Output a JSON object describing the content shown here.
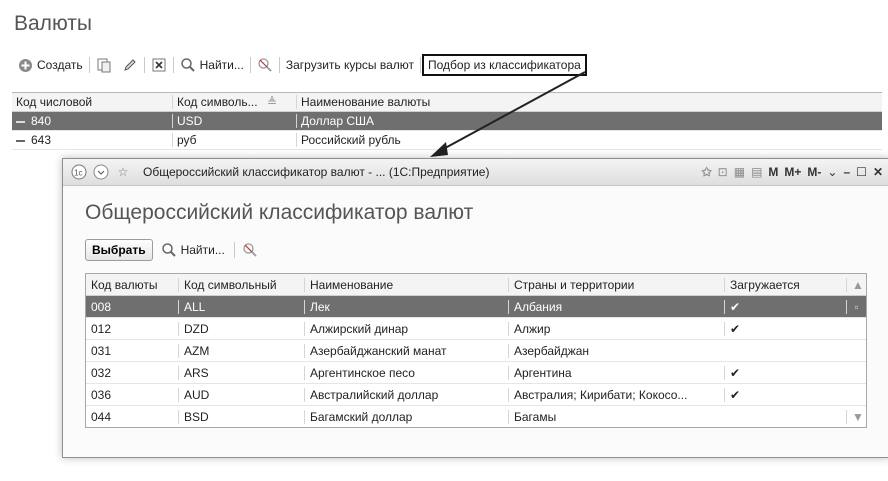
{
  "page": {
    "title": "Валюты"
  },
  "toolbar": {
    "create_label": "Создать",
    "find_label": "Найти...",
    "load_rates_label": "Загрузить курсы валют",
    "classifier_label": "Подбор из классификатора"
  },
  "grid": {
    "headers": [
      "Код числовой",
      "Код символь...",
      "Наименование валюты"
    ],
    "rows": [
      {
        "code": "840",
        "symbol": "USD",
        "name": "Доллар США"
      },
      {
        "code": "643",
        "symbol": "руб",
        "name": "Российский рубль"
      }
    ]
  },
  "modal": {
    "window_title": "Общероссийский классификатор валют - ... (1С:Предприятие)",
    "title": "Общероссийский классификатор валют",
    "select_label": "Выбрать",
    "find_label": "Найти...",
    "window_buttons": [
      "M",
      "M+",
      "M-"
    ],
    "headers": [
      "Код валюты",
      "Код символьный",
      "Наименование",
      "Страны и территории",
      "Загружается"
    ],
    "rows": [
      {
        "code": "008",
        "symbol": "ALL",
        "name": "Лек",
        "countries": "Албания",
        "loaded": "✔"
      },
      {
        "code": "012",
        "symbol": "DZD",
        "name": "Алжирский динар",
        "countries": "Алжир",
        "loaded": "✔"
      },
      {
        "code": "031",
        "symbol": "AZM",
        "name": "Азербайджанский манат",
        "countries": "Азербайджан",
        "loaded": ""
      },
      {
        "code": "032",
        "symbol": "ARS",
        "name": "Аргентинское песо",
        "countries": "Аргентина",
        "loaded": "✔"
      },
      {
        "code": "036",
        "symbol": "AUD",
        "name": "Австралийский доллар",
        "countries": "Австралия; Кирибати; Кокосо...",
        "loaded": "✔"
      },
      {
        "code": "044",
        "symbol": "BSD",
        "name": "Багамский доллар",
        "countries": "Багамы",
        "loaded": ""
      }
    ]
  }
}
